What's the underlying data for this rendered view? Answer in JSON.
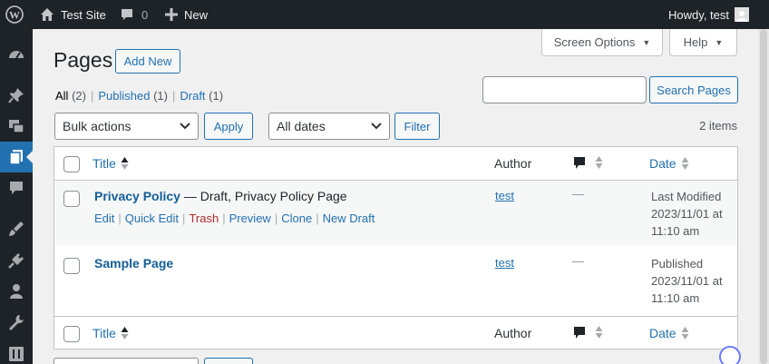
{
  "admin_bar": {
    "site_name": "Test Site",
    "comments_count": "0",
    "new_label": "New",
    "howdy": "Howdy, test"
  },
  "admin_menu": {
    "icons": [
      "dashboard-icon",
      "posts-pin-icon",
      "media-icon",
      "pages-icon",
      "comments-icon",
      "appearance-brush-icon",
      "plugins-icon",
      "users-icon",
      "tools-wrench-icon",
      "settings-icon"
    ],
    "current": "pages-icon"
  },
  "screen_meta": {
    "screen_options_label": "Screen Options",
    "help_label": "Help"
  },
  "page": {
    "title": "Pages",
    "add_new_label": "Add New"
  },
  "filters": {
    "all_label": "All",
    "all_count": "(2)",
    "published_label": "Published",
    "published_count": "(1)",
    "draft_label": "Draft",
    "draft_count": "(1)",
    "separator": "|"
  },
  "search": {
    "value": "",
    "button_label": "Search Pages"
  },
  "tablenav": {
    "bulk_actions": "Bulk actions",
    "apply_label": "Apply",
    "dates": "All dates",
    "filter_label": "Filter",
    "items_count": "2 items"
  },
  "table": {
    "columns": {
      "title": "Title",
      "author": "Author",
      "date": "Date"
    },
    "rows": [
      {
        "title": "Privacy Policy",
        "state": " — Draft, Privacy Policy Page",
        "author": "test",
        "comments": "—",
        "date_status": "Last Modified",
        "date_value": "2023/11/01 at",
        "date_time": "11:10 am",
        "actions": {
          "edit": "Edit",
          "quick_edit": "Quick Edit",
          "trash": "Trash",
          "preview": "Preview",
          "clone": "Clone",
          "new_draft": "New Draft"
        }
      },
      {
        "title": "Sample Page",
        "state": "",
        "author": "test",
        "comments": "—",
        "date_status": "Published",
        "date_value": "2023/11/01 at",
        "date_time": "11:10 am"
      }
    ]
  },
  "colors": {
    "admin_bar_bg": "#1d2327",
    "accent": "#2271b1",
    "trash": "#b32d2e",
    "background": "#f0f0f1"
  }
}
